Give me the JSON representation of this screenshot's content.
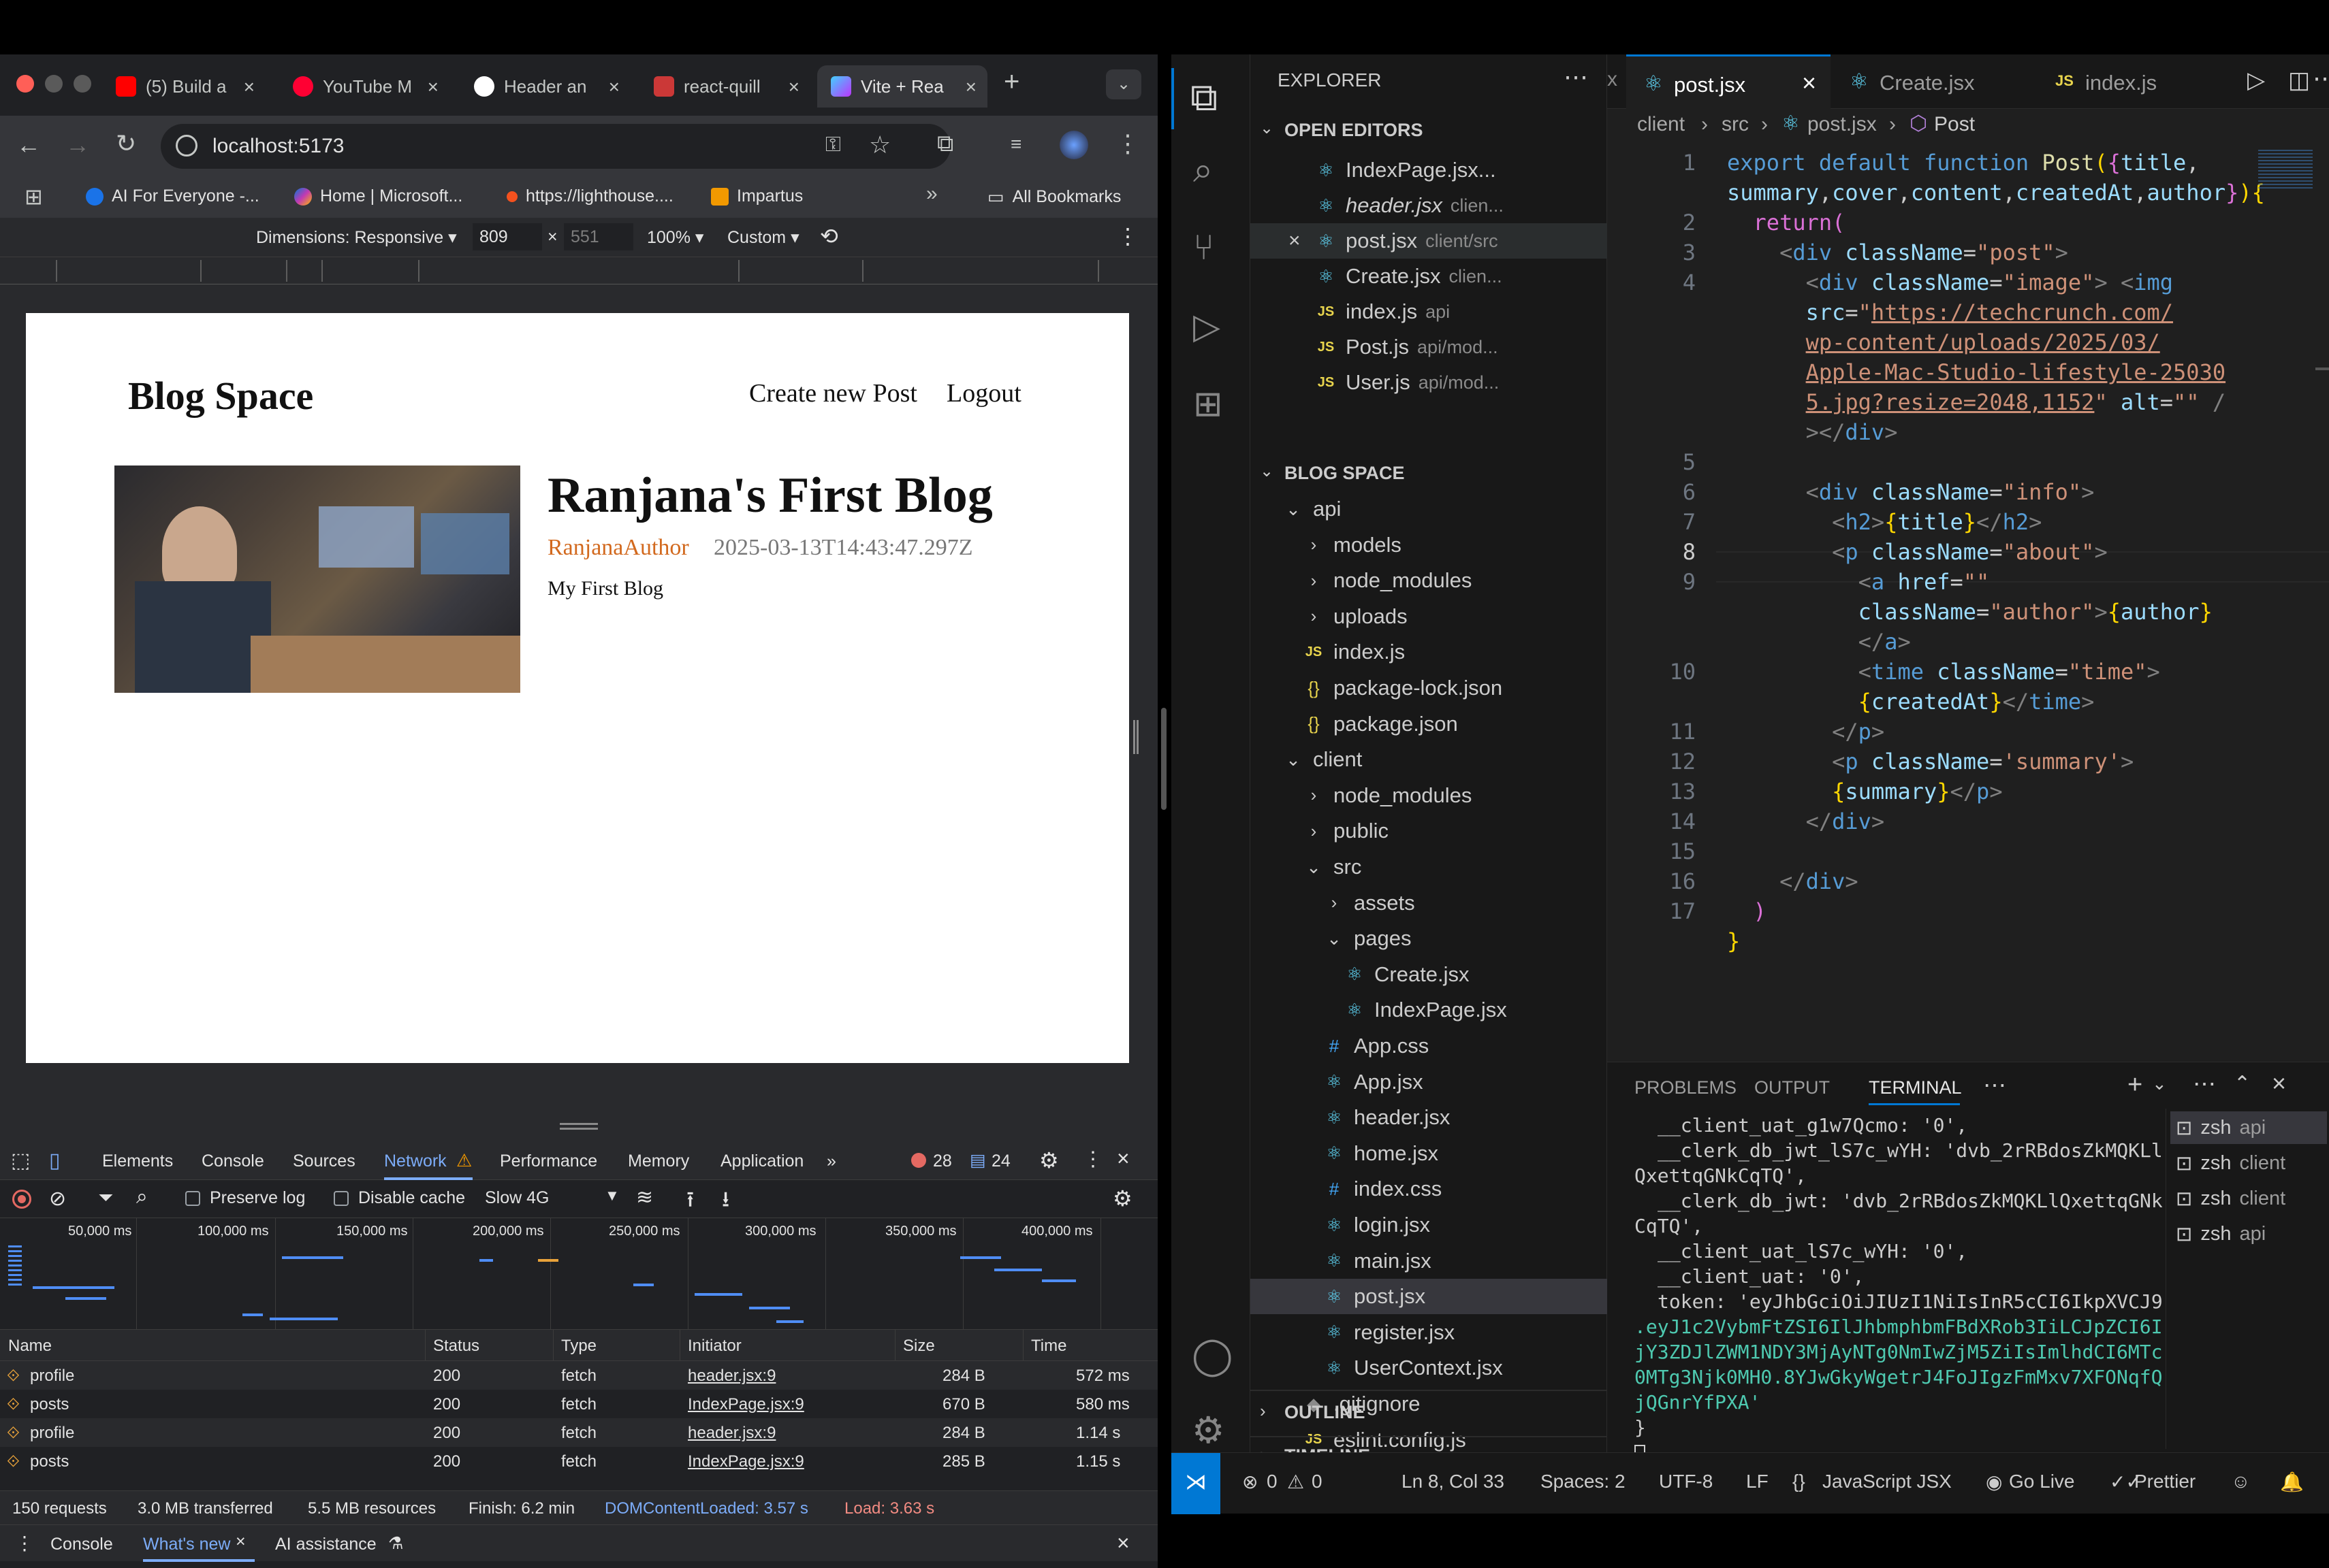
{
  "browser": {
    "tabs": [
      {
        "label": "(5) Build a",
        "color": "#ff0000"
      },
      {
        "label": "YouTube M",
        "color": "#ff0033"
      },
      {
        "label": "Header an",
        "color": "#ffffff"
      },
      {
        "label": "react-quill",
        "color": "#cb3837"
      },
      {
        "label": "Vite + Rea",
        "color": "#a855f7"
      }
    ],
    "new_tab": "+",
    "url": "localhost:5173",
    "bookmarks": [
      "AI For Everyone -...",
      "Home | Microsoft...",
      "https://lighthouse....",
      "Impartus"
    ],
    "bookmarks_more": "»",
    "all_bookmarks": "All Bookmarks",
    "device": {
      "dimensions_label": "Dimensions: Responsive ▾",
      "width": "809",
      "times": "×",
      "height": "551",
      "zoom": "100% ▾",
      "throttle": "Custom ▾"
    }
  },
  "site": {
    "logo": "Blog Space",
    "nav": [
      "Create new Post",
      "Logout"
    ],
    "post": {
      "title": "Ranjana's First Blog",
      "author": "RanjanaAuthor",
      "time": "2025-03-13T14:43:47.297Z",
      "summary": "My First Blog"
    }
  },
  "devtools": {
    "tabs": [
      "Elements",
      "Console",
      "Sources",
      "Network",
      "Performance",
      "Memory",
      "Application"
    ],
    "errors": "28",
    "messages": "24",
    "filters": {
      "preserve": "Preserve log",
      "disable_cache": "Disable cache",
      "throttling": "Slow 4G"
    },
    "timeline_ticks": [
      "50,000 ms",
      "100,000 ms",
      "150,000 ms",
      "200,000 ms",
      "250,000 ms",
      "300,000 ms",
      "350,000 ms",
      "400,000 ms"
    ],
    "columns": [
      "Name",
      "Status",
      "Type",
      "Initiator",
      "Size",
      "Time"
    ],
    "rows": [
      {
        "name": "profile",
        "status": "200",
        "type": "fetch",
        "initiator": "header.jsx:9",
        "size": "284 B",
        "time": "572 ms"
      },
      {
        "name": "posts",
        "status": "200",
        "type": "fetch",
        "initiator": "IndexPage.jsx:9",
        "size": "670 B",
        "time": "580 ms"
      },
      {
        "name": "profile",
        "status": "200",
        "type": "fetch",
        "initiator": "header.jsx:9",
        "size": "284 B",
        "time": "1.14 s"
      },
      {
        "name": "posts",
        "status": "200",
        "type": "fetch",
        "initiator": "IndexPage.jsx:9",
        "size": "285 B",
        "time": "1.15 s"
      }
    ],
    "summary": {
      "requests": "150 requests",
      "transferred": "3.0 MB transferred",
      "resources": "5.5 MB resources",
      "finish": "Finish: 6.2 min",
      "dcl": "DOMContentLoaded: 3.57 s",
      "load": "Load: 3.63 s"
    },
    "drawer": [
      "Console",
      "What's new",
      "AI assistance"
    ]
  },
  "vscode": {
    "explorer_title": "EXPLORER",
    "open_editors_title": "OPEN EDITORS",
    "open_editors": [
      {
        "name": "IndexPage.jsx...",
        "path": "",
        "icon": "react"
      },
      {
        "name": "header.jsx",
        "path": "clien...",
        "icon": "react"
      },
      {
        "name": "post.jsx",
        "path": "client/src",
        "icon": "react"
      },
      {
        "name": "Create.jsx",
        "path": "clien...",
        "icon": "react"
      },
      {
        "name": "index.js",
        "path": "api",
        "icon": "js"
      },
      {
        "name": "Post.js",
        "path": "api/mod...",
        "icon": "js"
      },
      {
        "name": "User.js",
        "path": "api/mod...",
        "icon": "js"
      }
    ],
    "project_title": "BLOG SPACE",
    "tree": [
      {
        "name": "api",
        "indent": 1,
        "kind": "open-folder"
      },
      {
        "name": "models",
        "indent": 2,
        "kind": "folder"
      },
      {
        "name": "node_modules",
        "indent": 2,
        "kind": "folder"
      },
      {
        "name": "uploads",
        "indent": 2,
        "kind": "folder"
      },
      {
        "name": "index.js",
        "indent": 2,
        "kind": "js"
      },
      {
        "name": "package-lock.json",
        "indent": 2,
        "kind": "json"
      },
      {
        "name": "package.json",
        "indent": 2,
        "kind": "json"
      },
      {
        "name": "client",
        "indent": 1,
        "kind": "open-folder"
      },
      {
        "name": "node_modules",
        "indent": 2,
        "kind": "folder"
      },
      {
        "name": "public",
        "indent": 2,
        "kind": "folder"
      },
      {
        "name": "src",
        "indent": 2,
        "kind": "open-folder"
      },
      {
        "name": "assets",
        "indent": 3,
        "kind": "folder"
      },
      {
        "name": "pages",
        "indent": 3,
        "kind": "open-folder"
      },
      {
        "name": "Create.jsx",
        "indent": 4,
        "kind": "react"
      },
      {
        "name": "IndexPage.jsx",
        "indent": 4,
        "kind": "react"
      },
      {
        "name": "App.css",
        "indent": 3,
        "kind": "css"
      },
      {
        "name": "App.jsx",
        "indent": 3,
        "kind": "react"
      },
      {
        "name": "header.jsx",
        "indent": 3,
        "kind": "react"
      },
      {
        "name": "home.jsx",
        "indent": 3,
        "kind": "react"
      },
      {
        "name": "index.css",
        "indent": 3,
        "kind": "css"
      },
      {
        "name": "login.jsx",
        "indent": 3,
        "kind": "react"
      },
      {
        "name": "main.jsx",
        "indent": 3,
        "kind": "react"
      },
      {
        "name": "post.jsx",
        "indent": 3,
        "kind": "react"
      },
      {
        "name": "register.jsx",
        "indent": 3,
        "kind": "react"
      },
      {
        "name": "UserContext.jsx",
        "indent": 3,
        "kind": "react"
      },
      {
        "name": ".gitignore",
        "indent": 2,
        "kind": "git"
      },
      {
        "name": "eslint.config.js",
        "indent": 2,
        "kind": "js"
      }
    ],
    "outline": "OUTLINE",
    "timeline": "TIMELINE",
    "editor_tabs": [
      {
        "name": "post.jsx",
        "icon": "react"
      },
      {
        "name": "Create.jsx",
        "icon": "react"
      },
      {
        "name": "index.js",
        "icon": "js"
      }
    ],
    "breadcrumb": [
      "client",
      "src",
      "post.jsx",
      "Post"
    ],
    "line_numbers": [
      "1",
      "2",
      "3",
      "4",
      "5",
      "6",
      "7",
      "8",
      "9",
      "10",
      "11",
      "12",
      "13",
      "14",
      "15",
      "16",
      "17"
    ],
    "panel_tabs": [
      "PROBLEMS",
      "OUTPUT",
      "TERMINAL"
    ],
    "terminal_lines": [
      "__client_uat_g1w7Qcmo: '0',",
      "__clerk_db_jwt_lS7c_wYH: 'dvb_2rRBdosZkMQKLl",
      "QxettqGNkCqTQ',",
      "__clerk_db_jwt: 'dvb_2rRBdosZkMQKLlQxettqGNk",
      "CqTQ',",
      "__client_uat_lS7c_wYH: '0',",
      "__client_uat: '0',",
      "token: 'eyJhbGciOiJIUzI1NiIsInR5cCI6IkpXVCJ9",
      ".eyJ1c2VybmFtZSI6IlJhbmphbmFBdXRob3IiLCJpZCI6I",
      "jY3ZDJlZWM1NDY3MjAyNTg0NmIwZjM5ZiIsImlhdCI6MTc",
      "0MTg3Njk0MH0.8YJwGkyWgetrJ4FoJIgzFmMxv7XFONqfQ",
      "jQGnrYfPXA'",
      "}"
    ],
    "shells": [
      {
        "name": "zsh",
        "dir": "api"
      },
      {
        "name": "zsh",
        "dir": "client"
      },
      {
        "name": "zsh",
        "dir": "client"
      },
      {
        "name": "zsh",
        "dir": "api"
      }
    ],
    "status": {
      "errors": "0",
      "warnings": "0",
      "position": "Ln 8, Col 33",
      "spaces": "Spaces: 2",
      "encoding": "UTF-8",
      "eol": "LF",
      "language": "JavaScript JSX",
      "golive": "Go Live",
      "prettier": "Prettier"
    }
  }
}
